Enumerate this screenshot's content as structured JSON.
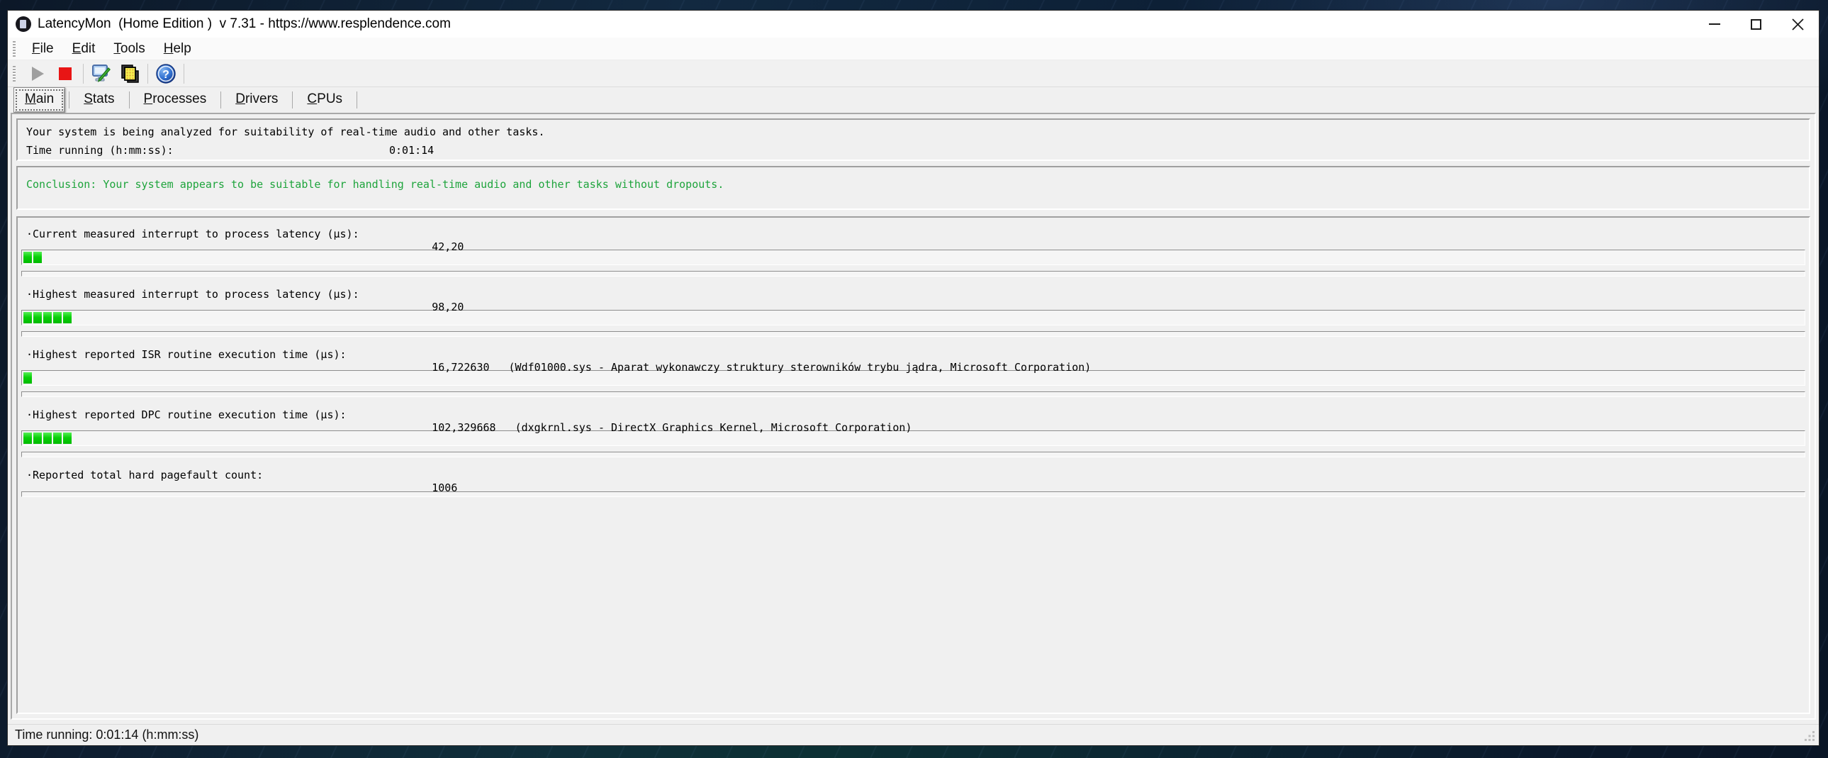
{
  "window": {
    "title": "LatencyMon  (Home Edition )  v 7.31 - https://www.resplendence.com",
    "app_icon": "latencymon-logo-icon",
    "controls": [
      "minimize-icon",
      "maximize-icon",
      "close-icon"
    ]
  },
  "menu": {
    "items": [
      {
        "label": "File"
      },
      {
        "label": "Edit"
      },
      {
        "label": "Tools"
      },
      {
        "label": "Help"
      }
    ]
  },
  "toolbar": {
    "buttons": [
      {
        "icon": "play-icon",
        "enabled": false
      },
      {
        "icon": "stop-icon",
        "enabled": true
      },
      {
        "icon": "options-monitor-icon",
        "enabled": true
      },
      {
        "icon": "copy-report-icon",
        "enabled": true
      },
      {
        "icon": "help-icon",
        "enabled": true
      }
    ]
  },
  "tabs": [
    {
      "label": "Main",
      "selected": true
    },
    {
      "label": "Stats",
      "selected": false
    },
    {
      "label": "Processes",
      "selected": false
    },
    {
      "label": "Drivers",
      "selected": false
    },
    {
      "label": "CPUs",
      "selected": false
    }
  ],
  "main": {
    "analysis_line": "Your system is being analyzed for suitability of real-time audio and other tasks.",
    "time_running_label": "Time running (h:mm:ss):",
    "time_running_value": "0:01:14",
    "conclusion": "Conclusion: Your system appears to be suitable for handling real-time audio and other tasks without dropouts.",
    "metrics": [
      {
        "label": "·Current measured interrupt to process latency (µs):",
        "value": "42,20",
        "detail": "",
        "segments": 2,
        "no_bar": false
      },
      {
        "label": "·Highest measured interrupt to process latency (µs):",
        "value": "98,20",
        "detail": "",
        "segments": 5,
        "no_bar": false
      },
      {
        "label": "·Highest reported ISR routine execution time (µs):",
        "value": "16,722630",
        "detail": "(Wdf01000.sys - Aparat wykonawczy struktury sterowników trybu jądra, Microsoft Corporation)",
        "segments": 1,
        "no_bar": false
      },
      {
        "label": "·Highest reported DPC routine execution time (µs):",
        "value": "102,329668",
        "detail": "(dxgkrnl.sys - DirectX Graphics Kernel, Microsoft Corporation)",
        "segments": 5,
        "no_bar": false
      },
      {
        "label": "·Reported total hard pagefault count:",
        "value": "1006",
        "detail": "",
        "segments": 0,
        "no_bar": true
      }
    ]
  },
  "statusbar": {
    "text": "Time running: 0:01:14  (h:mm:ss)"
  },
  "colors": {
    "conclusion_green": "#1ea43c",
    "bar_green": "#00c800",
    "stop_red": "#e81515",
    "help_blue": "#2f6fd0",
    "titlebar_bg": "#ffffff",
    "client_bg": "#f0f0f0"
  }
}
